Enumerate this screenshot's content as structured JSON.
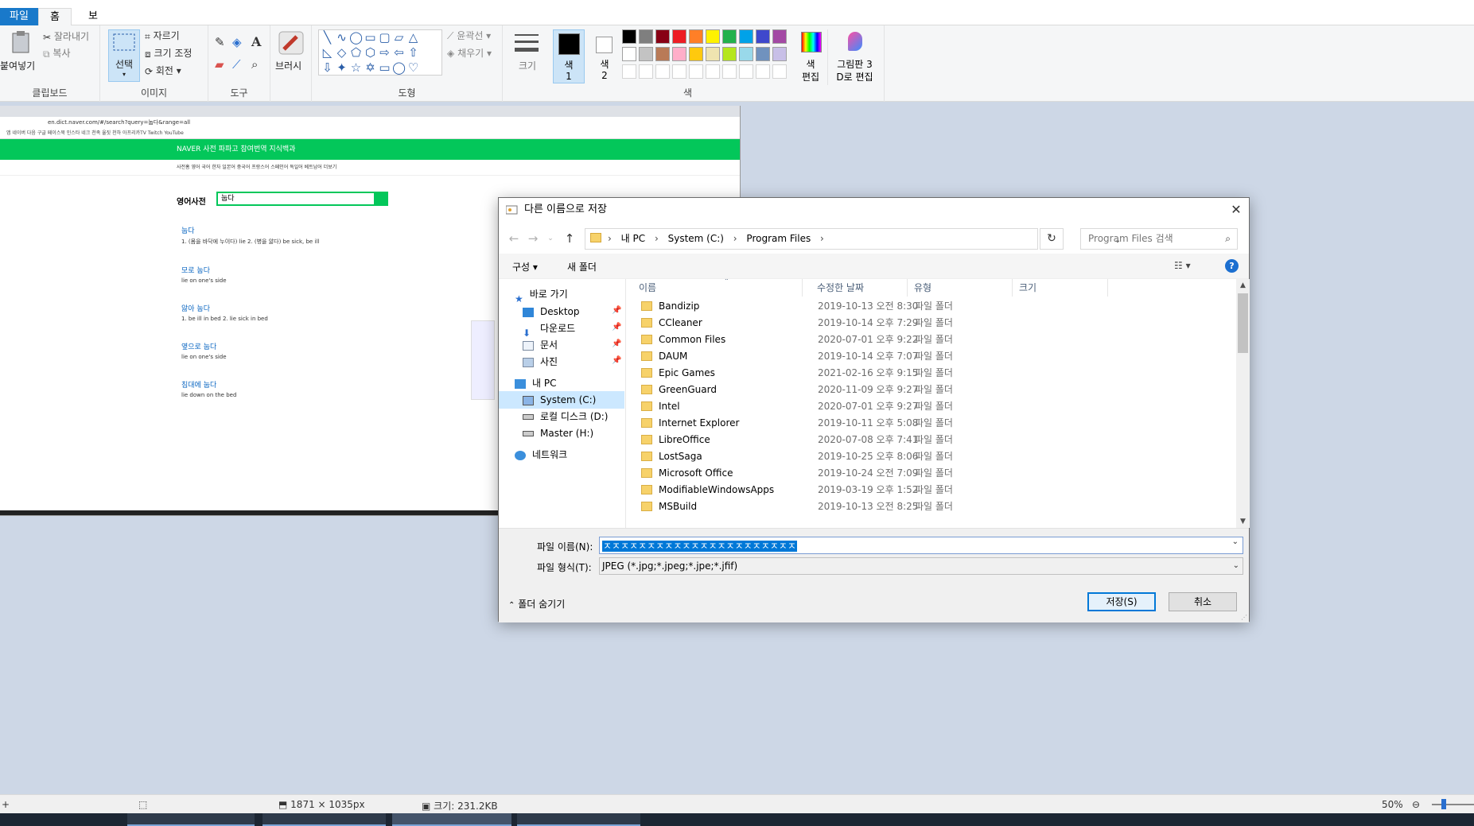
{
  "menu": {
    "file": "파일",
    "home": "홈",
    "view": "보기"
  },
  "ribbon": {
    "clipboard": {
      "paste": "붙여넣기",
      "cut": "잘라내기",
      "copy": "복사",
      "label": "클립보드"
    },
    "image": {
      "select": "선택",
      "crop": "자르기",
      "resize": "크기 조정",
      "rotate": "회전",
      "label": "이미지"
    },
    "tools": {
      "label": "도구"
    },
    "brushes": {
      "label": "브러시"
    },
    "shapes": {
      "outline": "윤곽선",
      "fill": "채우기",
      "label": "도형"
    },
    "size": {
      "label": "크기"
    },
    "colors": {
      "color1_a": "색",
      "color1_b": "1",
      "color2_a": "색",
      "color2_b": "2",
      "edit_a": "색",
      "edit_b": "편집",
      "paint3d_a": "그림판 3",
      "paint3d_b": "D로 편집",
      "label": "색",
      "palette_row1": [
        "#000000",
        "#7f7f7f",
        "#880015",
        "#ed1c24",
        "#ff7f27",
        "#fff200",
        "#22b14c",
        "#00a2e8",
        "#3f48cc",
        "#a349a4"
      ],
      "palette_row2": [
        "#ffffff",
        "#c3c3c3",
        "#b97a57",
        "#ffaec9",
        "#ffc90e",
        "#efe4b0",
        "#b5e61d",
        "#99d9ea",
        "#7092be",
        "#c8bfe7"
      ],
      "color1": "#000000",
      "color2": "#ffffff"
    }
  },
  "embedded_page": {
    "url": "en.dict.naver.com/#/search?query=눕다&range=all",
    "bookmarks": "앱  네이버  다음  구글  페이스북  인스타  네크 천족  율짓 천하  아프리카TV  Twitch  YouTube",
    "naver_bar": "NAVER 사전   파파고   참여번역   지식백과",
    "subnav": "사전홈   영어   국어   한자   일본어   중국어   프랑스어   스페인어   독일어   베트남어   더보기",
    "dict_title": "영어사전",
    "query": "눕다",
    "entries": [
      {
        "headword": "눕다",
        "def": "1. (몸을 바닥에 누이다) lie   2. (병을 앓다) be sick, be ill"
      },
      {
        "headword": "모로 눕다",
        "def": "lie on one's side"
      },
      {
        "headword": "앓아 눕다",
        "def": "1. be ill in bed   2. lie sick in bed"
      },
      {
        "headword": "옆으로 눕다",
        "def": "lie on one's side"
      },
      {
        "headword": "침대에 눕다",
        "def": "lie down on the bed"
      }
    ]
  },
  "dialog": {
    "title": "다른 이름으로 저장",
    "breadcrumb": [
      "내 PC",
      "System (C:)",
      "Program Files"
    ],
    "search_placeholder": "Program Files 검색",
    "organize": "구성 ▾",
    "new_folder": "새 폴더",
    "help": "?",
    "nav": {
      "quick_access": "바로 가기",
      "desktop": "Desktop",
      "downloads": "다운로드",
      "documents": "문서",
      "pictures": "사진",
      "this_pc": "내 PC",
      "system_c": "System (C:)",
      "local_d": "로컬 디스크 (D:)",
      "master_h": "Master (H:)",
      "network": "네트워크"
    },
    "columns": {
      "name": "이름",
      "modified": "수정한 날짜",
      "type": "유형",
      "size": "크기"
    },
    "files": [
      {
        "name": "Bandizip",
        "date": "2019-10-13 오전 8:30",
        "type": "파일 폴더"
      },
      {
        "name": "CCleaner",
        "date": "2019-10-14 오후 7:29",
        "type": "파일 폴더"
      },
      {
        "name": "Common Files",
        "date": "2020-07-01 오후 9:22",
        "type": "파일 폴더"
      },
      {
        "name": "DAUM",
        "date": "2019-10-14 오후 7:07",
        "type": "파일 폴더"
      },
      {
        "name": "Epic Games",
        "date": "2021-02-16 오후 9:15",
        "type": "파일 폴더"
      },
      {
        "name": "GreenGuard",
        "date": "2020-11-09 오후 9:27",
        "type": "파일 폴더"
      },
      {
        "name": "Intel",
        "date": "2020-07-01 오후 9:27",
        "type": "파일 폴더"
      },
      {
        "name": "Internet Explorer",
        "date": "2019-10-11 오후 5:08",
        "type": "파일 폴더"
      },
      {
        "name": "LibreOffice",
        "date": "2020-07-08 오후 7:41",
        "type": "파일 폴더"
      },
      {
        "name": "LostSaga",
        "date": "2019-10-25 오후 8:06",
        "type": "파일 폴더"
      },
      {
        "name": "Microsoft Office",
        "date": "2019-10-24 오전 7:09",
        "type": "파일 폴더"
      },
      {
        "name": "ModifiableWindowsApps",
        "date": "2019-03-19 오후 1:52",
        "type": "파일 폴더"
      },
      {
        "name": "MSBuild",
        "date": "2019-10-13 오전 8:25",
        "type": "파일 폴더"
      }
    ],
    "filename_label": "파일 이름(N):",
    "filename_value": "ㅈㅈㅈㅈㅈㅈㅈㅈㅈㅈㅈㅈㅈㅈㅈㅈㅈㅈㅈㅈㅈㅈ",
    "filetype_label": "파일 형식(T):",
    "filetype_value": "JPEG (*.jpg;*.jpeg;*.jpe;*.jfif)",
    "hide_folders": "폴더 숨기기",
    "save": "저장(S)",
    "cancel": "취소"
  },
  "status": {
    "dimensions": "1871 × 1035px",
    "filesize": "크기: 231.2KB",
    "zoom": "50%"
  }
}
